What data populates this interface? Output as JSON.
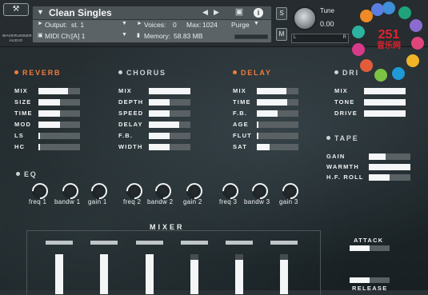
{
  "logo": {
    "icon": "wrench-icon",
    "brand": "WAVERUNNER AUDIO"
  },
  "header": {
    "instrument_name": "Clean Singles",
    "output_label": "Output:",
    "output_value": "st. 1",
    "voices_label": "Voices:",
    "voices_value": "0",
    "max_label": "Max:",
    "max_value": "1024",
    "purge_label": "Purge",
    "midi_label": "MIDI Ch:",
    "midi_value": "[A]  1",
    "memory_label": "Memory:",
    "memory_value": "58.83 MB"
  },
  "side_buttons": {
    "solo": "S",
    "mute": "M"
  },
  "tune": {
    "label": "Tune",
    "value": "0.00",
    "left": "L",
    "right": "R"
  },
  "badge": {
    "text": "251",
    "sub": "音乐网"
  },
  "reverb": {
    "title": "REVERB",
    "params": [
      {
        "label": "MIX",
        "value": 0.72
      },
      {
        "label": "SIZE",
        "value": 0.52
      },
      {
        "label": "TIME",
        "value": 0.52
      },
      {
        "label": "MOD",
        "value": 0.52
      },
      {
        "label": "LS",
        "value": 0.04
      },
      {
        "label": "HC",
        "value": 0.04
      }
    ]
  },
  "chorus": {
    "title": "CHORUS",
    "params": [
      {
        "label": "MIX",
        "value": 1.0
      },
      {
        "label": "DEPTH",
        "value": 0.5
      },
      {
        "label": "SPEED",
        "value": 0.5
      },
      {
        "label": "DELAY",
        "value": 0.74
      },
      {
        "label": "F.B.",
        "value": 0.5
      },
      {
        "label": "WIDTH",
        "value": 0.5
      }
    ]
  },
  "delay": {
    "title": "DELAY",
    "params": [
      {
        "label": "MIX",
        "value": 0.72
      },
      {
        "label": "TIME",
        "value": 0.74
      },
      {
        "label": "F.B.",
        "value": 0.5
      },
      {
        "label": "AGE",
        "value": 0.04
      },
      {
        "label": "FLUT",
        "value": 0.04
      },
      {
        "label": "SAT",
        "value": 0.3
      }
    ]
  },
  "drive": {
    "title": "DRI",
    "params": [
      {
        "label": "MIX",
        "value": 1.0
      },
      {
        "label": "TONE",
        "value": 1.0
      },
      {
        "label": "DRIVE",
        "value": 1.0
      }
    ]
  },
  "tape": {
    "title": "TAPE",
    "params": [
      {
        "label": "GAIN",
        "value": 0.4
      },
      {
        "label": "WARMTH",
        "value": 1.0
      },
      {
        "label": "H.F. ROLL",
        "value": 0.5
      }
    ]
  },
  "eq": {
    "title": "EQ",
    "knobs": [
      "freq 1",
      "bandw 1",
      "gain 1",
      "freq 2",
      "bandw 2",
      "gain 2",
      "freq 3",
      "bandw 3",
      "gain 3"
    ]
  },
  "mixer": {
    "title": "MIXER",
    "channels": [
      0.0,
      0.0,
      0.0,
      0.15,
      0.15,
      0.15
    ]
  },
  "envelope": {
    "attack_label": "ATTACK",
    "attack_value": 0.5,
    "release_label": "RELEASE",
    "release_value": 0.5
  }
}
